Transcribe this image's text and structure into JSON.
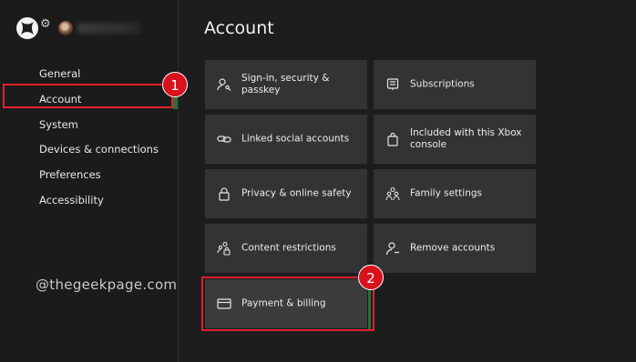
{
  "sidebar": {
    "items": [
      {
        "label": "General"
      },
      {
        "label": "Account"
      },
      {
        "label": "System"
      },
      {
        "label": "Devices & connections"
      },
      {
        "label": "Preferences"
      },
      {
        "label": "Accessibility"
      }
    ],
    "selected": "Account"
  },
  "watermark": "@thegeekpage.com",
  "badges": [
    "1",
    "2"
  ],
  "main": {
    "title": "Account",
    "tiles": [
      {
        "label": "Sign-in, security & passkey",
        "icon": "person-key-icon"
      },
      {
        "label": "Subscriptions",
        "icon": "document-list-icon"
      },
      {
        "label": "Linked social accounts",
        "icon": "link-icon"
      },
      {
        "label": "Included with this Xbox console",
        "icon": "bag-icon"
      },
      {
        "label": "Privacy & online safety",
        "icon": "lock-icon"
      },
      {
        "label": "Family settings",
        "icon": "family-icon"
      },
      {
        "label": "Content restrictions",
        "icon": "people-lock-icon"
      },
      {
        "label": "Remove accounts",
        "icon": "person-remove-icon"
      },
      {
        "label": "Payment & billing",
        "icon": "credit-card-icon"
      }
    ]
  },
  "colors": {
    "highlight_red": "#e0202a",
    "badge_red": "#d8111c",
    "tile_bg": "#333333",
    "focus_green": "#2d6e3b"
  }
}
